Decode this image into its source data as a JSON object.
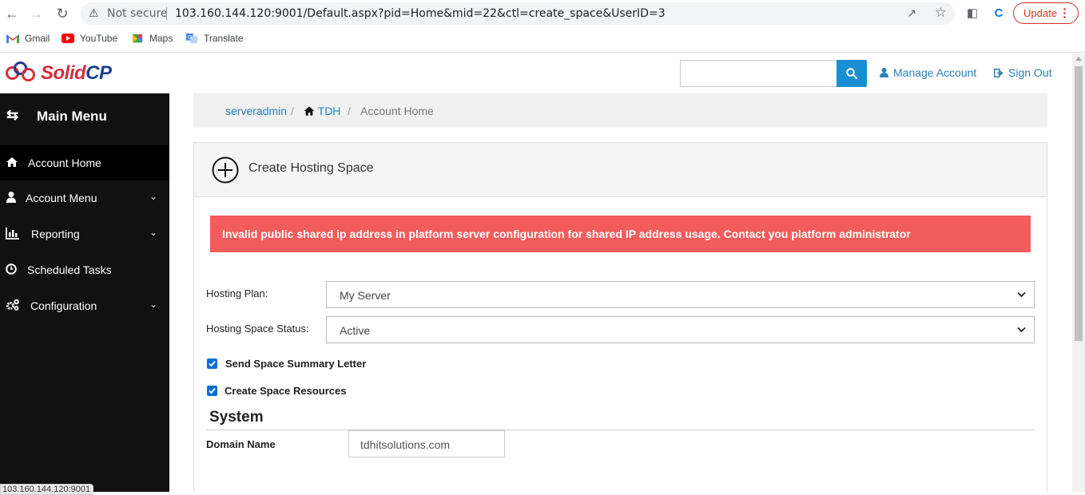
{
  "browser": {
    "not_secure": "Not secure",
    "url": "103.160.144.120:9001/Default.aspx?pid=Home&mid=22&ctl=create_space&UserID=3",
    "update_label": "Update",
    "bookmarks": [
      {
        "label": "Gmail",
        "icon": "gmail-icon"
      },
      {
        "label": "YouTube",
        "icon": "youtube-icon"
      },
      {
        "label": "Maps",
        "icon": "maps-icon"
      },
      {
        "label": "Translate",
        "icon": "translate-icon"
      }
    ],
    "status_url": "103.160.144.120:9001"
  },
  "header": {
    "logo_solid": "Solid",
    "logo_cp": "CP",
    "search_value": "",
    "manage_account": "Manage Account",
    "sign_out": "Sign Out",
    "accent": "#1a8fd1"
  },
  "sidebar": {
    "title": "Main Menu",
    "items": [
      {
        "label": "Account Home",
        "icon": "home-icon",
        "active": true
      },
      {
        "label": "Account Menu",
        "icon": "user-icon",
        "expandable": true
      },
      {
        "label": "Reporting",
        "icon": "bar-chart-icon",
        "expandable": true
      },
      {
        "label": "Scheduled Tasks",
        "icon": "clock-icon"
      },
      {
        "label": "Configuration",
        "icon": "gears-icon",
        "expandable": true
      }
    ]
  },
  "breadcrumb": {
    "user": "serveradmin",
    "sep1": "/",
    "home": "TDH",
    "sep2": "/",
    "current": "Account Home"
  },
  "panel": {
    "title": "Create Hosting Space",
    "alert": "Invalid public shared ip address in platform server configuration for shared IP address usage. Contact you platform administrator",
    "alert_color": "#f25c5c",
    "hosting_plan_label": "Hosting Plan:",
    "hosting_plan_value": "My Server",
    "status_label": "Hosting Space Status:",
    "status_value": "Active",
    "send_summary_label": "Send Space Summary Letter",
    "send_summary_checked": true,
    "create_resources_label": "Create Space Resources",
    "create_resources_checked": true,
    "section_title": "System",
    "domain_label": "Domain Name",
    "domain_value": "tdhitsolutions.com"
  }
}
